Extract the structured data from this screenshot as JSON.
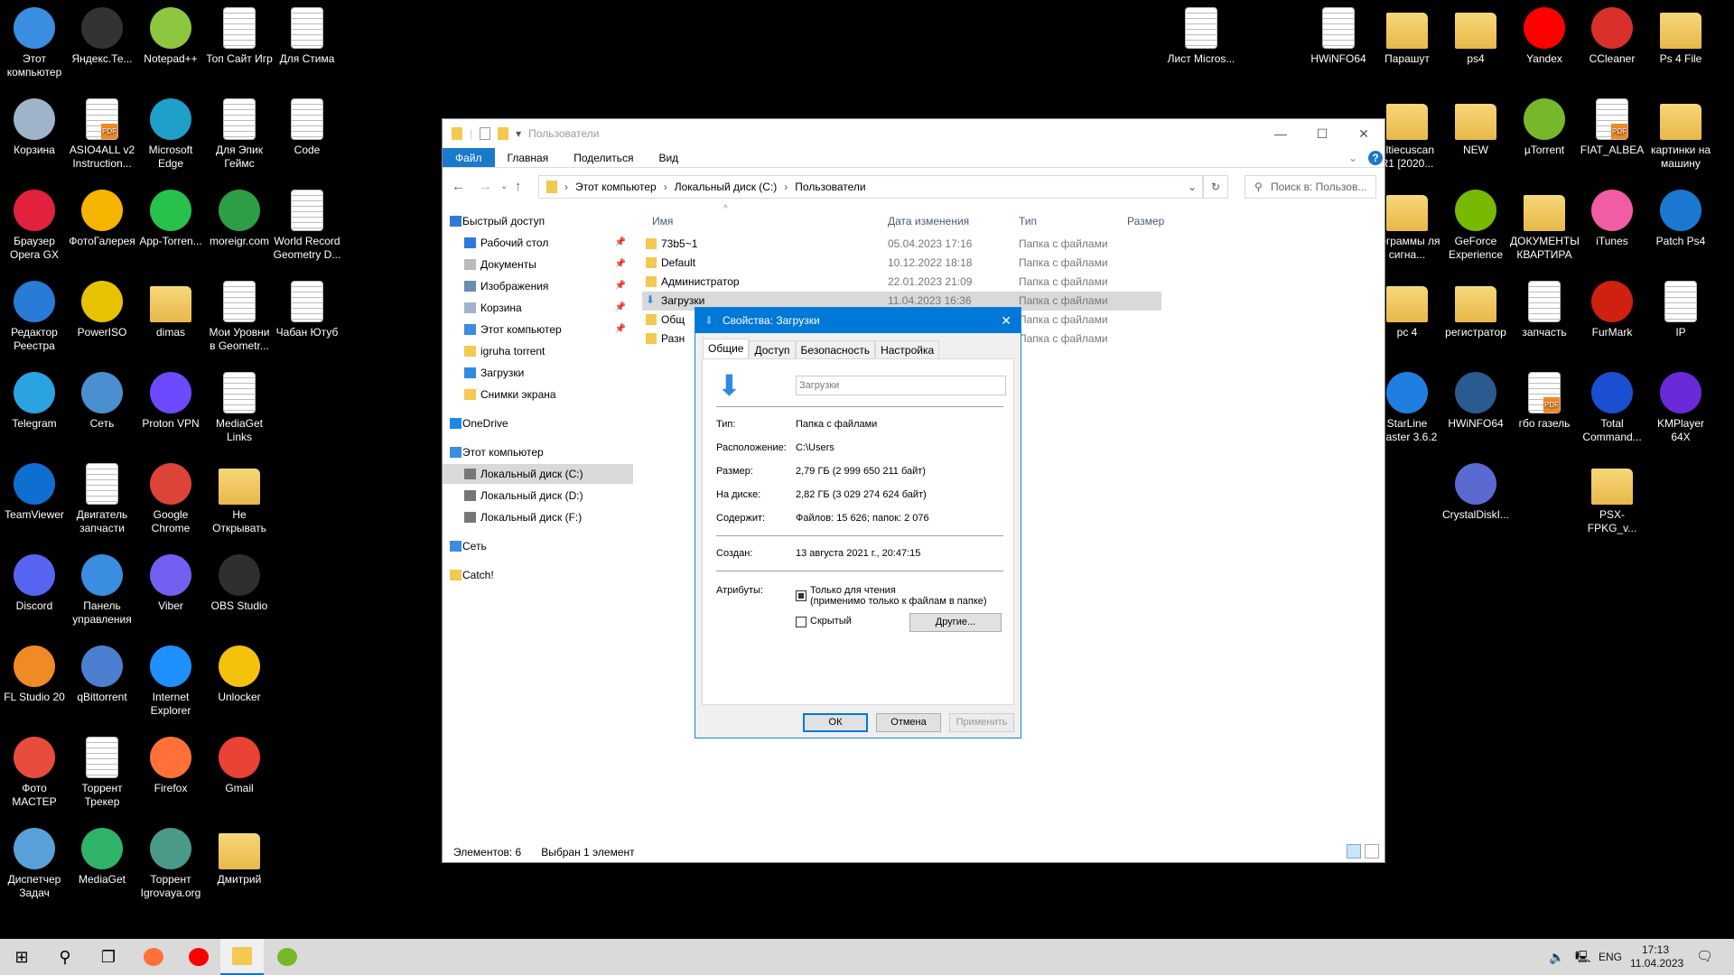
{
  "desktop": {
    "left_columns": [
      [
        {
          "label": "Этот компьютер",
          "icon": "computer",
          "color": "#3a8de0"
        },
        {
          "label": "Корзина",
          "icon": "recycle-bin",
          "color": "#9fb4c8"
        },
        {
          "label": "Браузер Opera GX",
          "icon": "opera-gx",
          "color": "#e2213d"
        },
        {
          "label": "Редактор Реестра",
          "icon": "regedit",
          "color": "#2a7ad8"
        },
        {
          "label": "Telegram",
          "icon": "telegram",
          "color": "#2aa3e0"
        },
        {
          "label": "TeamViewer",
          "icon": "teamviewer",
          "color": "#0e6fd0"
        },
        {
          "label": "Discord",
          "icon": "discord",
          "color": "#5865f2"
        },
        {
          "label": "FL Studio 20",
          "icon": "fl-studio",
          "color": "#f08a24"
        },
        {
          "label": "Фото МАСТЕР",
          "icon": "photo-master",
          "color": "#e84c3d"
        },
        {
          "label": "Диспетчер Задач",
          "icon": "task-manager",
          "color": "#5aa0d8"
        }
      ],
      [
        {
          "label": "Яндекс.Те...",
          "icon": "yandex-telemost",
          "color": "#333333"
        },
        {
          "label": "ASIO4ALL v2 Instruction...",
          "icon": "pdf",
          "color": "#eeeeee"
        },
        {
          "label": "ФотоГалерея",
          "icon": "photo-gallery",
          "color": "#f4b400"
        },
        {
          "label": "PowerISO",
          "icon": "poweriso",
          "color": "#e8c200"
        },
        {
          "label": "Сеть",
          "icon": "network",
          "color": "#4a90d0"
        },
        {
          "label": "Двигатель запчасти",
          "icon": "word-doc",
          "color": "#2b5797"
        },
        {
          "label": "Панель управления",
          "icon": "control-panel",
          "color": "#3a8de0"
        },
        {
          "label": "qBittorrent",
          "icon": "qbittorrent",
          "color": "#4c7fd0"
        },
        {
          "label": "Торрент Трекер",
          "icon": "doc",
          "color": "#ffffff"
        },
        {
          "label": "MediaGet",
          "icon": "mediaget",
          "color": "#2fb36b"
        }
      ],
      [
        {
          "label": "Notepad++",
          "icon": "notepad-plus",
          "color": "#8dc63f"
        },
        {
          "label": "Microsoft Edge",
          "icon": "edge",
          "color": "#1fa0c8"
        },
        {
          "label": "App-Torren...",
          "icon": "app-torrent",
          "color": "#27c24c"
        },
        {
          "label": "dimas",
          "icon": "user-folder",
          "color": "#e8b84a"
        },
        {
          "label": "Proton VPN",
          "icon": "proton-vpn",
          "color": "#6d4aff"
        },
        {
          "label": "Google Chrome",
          "icon": "chrome",
          "color": "#db4437"
        },
        {
          "label": "Viber",
          "icon": "viber",
          "color": "#7360f2"
        },
        {
          "label": "Internet Explorer",
          "icon": "internet-explorer",
          "color": "#1e90ff"
        },
        {
          "label": "Firefox",
          "icon": "firefox",
          "color": "#ff7139"
        },
        {
          "label": "Торрент Igrovaya.org",
          "icon": "utorrent",
          "color": "#4a9a8a"
        }
      ],
      [
        {
          "label": "Топ Сайт Игр",
          "icon": "doc",
          "color": "#ffffff"
        },
        {
          "label": "Для Эпик Геймс",
          "icon": "doc",
          "color": "#ffffff"
        },
        {
          "label": "moreigr.com",
          "icon": "moreigr",
          "color": "#2e9e44"
        },
        {
          "label": "Мои Уровни в Geometr...",
          "icon": "doc",
          "color": "#ffffff"
        },
        {
          "label": "MediaGet Links",
          "icon": "doc",
          "color": "#ffffff"
        },
        {
          "label": "Не Открывать",
          "icon": "folder",
          "color": "#e8b84a"
        },
        {
          "label": "OBS Studio",
          "icon": "obs",
          "color": "#302e31"
        },
        {
          "label": "Unlocker",
          "icon": "unlocker",
          "color": "#f4c20d"
        },
        {
          "label": "Gmail",
          "icon": "gmail",
          "color": "#ea4335"
        },
        {
          "label": "Дмитрий",
          "icon": "folder",
          "color": "#e8b84a"
        }
      ],
      [
        {
          "label": "Для Стима",
          "icon": "doc",
          "color": "#ffffff"
        },
        {
          "label": "Code",
          "icon": "doc",
          "color": "#ffffff"
        },
        {
          "label": "World Record Geometry D...",
          "icon": "doc",
          "color": "#ffffff"
        },
        {
          "label": "Чабан Ютуб",
          "icon": "doc",
          "color": "#ffffff"
        }
      ]
    ],
    "right_columns": [
      [
        {
          "label": "Лист Micros...",
          "icon": "excel",
          "color": "#1d7044"
        }
      ],
      [
        {
          "label": "HWiNFO64",
          "icon": "doc",
          "color": "#ffffff"
        }
      ],
      [
        {
          "label": "Парашут",
          "icon": "folder",
          "color": "#e8b84a"
        },
        {
          "label": "ultiecuscan R1 [2020...",
          "icon": "folder",
          "color": "#e8b84a"
        },
        {
          "label": "рограммы ля сигна...",
          "icon": "folder",
          "color": "#e8b84a"
        },
        {
          "label": "pc 4",
          "icon": "folder",
          "color": "#e8b84a"
        },
        {
          "label": "StarLine Master 3.6.2",
          "icon": "starline",
          "color": "#1f7fe0"
        }
      ],
      [
        {
          "label": "ps4",
          "icon": "folder",
          "color": "#e8b84a"
        },
        {
          "label": "NEW",
          "icon": "folder",
          "color": "#e8b84a"
        },
        {
          "label": "GeForce Experience",
          "icon": "geforce",
          "color": "#76b900"
        },
        {
          "label": "регистратор",
          "icon": "folder",
          "color": "#e8b84a"
        },
        {
          "label": "HWiNFO64",
          "icon": "hwinfo",
          "color": "#2a5a90"
        },
        {
          "label": "CrystalDiskI...",
          "icon": "crystaldisk",
          "color": "#5a6ad0"
        }
      ],
      [
        {
          "label": "Yandex",
          "icon": "yandex",
          "color": "#ff0000"
        },
        {
          "label": "µTorrent",
          "icon": "utorrent",
          "color": "#77b82a"
        },
        {
          "label": "ДОКУМЕНТЫ КВАРТИРА",
          "icon": "folder",
          "color": "#e8b84a"
        },
        {
          "label": "запчасть",
          "icon": "doc",
          "color": "#ffffff"
        },
        {
          "label": "гбо газель",
          "icon": "pdf",
          "color": "#eeeeee"
        }
      ],
      [
        {
          "label": "CCleaner",
          "icon": "ccleaner",
          "color": "#d9302c"
        },
        {
          "label": "FIAT_ALBEA",
          "icon": "pdf",
          "color": "#c8202a"
        },
        {
          "label": "iTunes",
          "icon": "itunes",
          "color": "#f25ca2"
        },
        {
          "label": "FurMark",
          "icon": "furmark",
          "color": "#d02010"
        },
        {
          "label": "Total Command...",
          "icon": "total-commander",
          "color": "#1a4fd0"
        },
        {
          "label": "PSX-FPKG_v...",
          "icon": "folder",
          "color": "#e8b84a"
        }
      ],
      [
        {
          "label": "Ps 4 File",
          "icon": "folder",
          "color": "#e8b84a"
        },
        {
          "label": "картинки на машину",
          "icon": "folder",
          "color": "#e8b84a"
        },
        {
          "label": "Patch Ps4",
          "icon": "patch",
          "color": "#1a78d0"
        },
        {
          "label": "IP",
          "icon": "doc",
          "color": "#ffffff"
        },
        {
          "label": "KMPlayer 64X",
          "icon": "kmplayer",
          "color": "#6a2ad8"
        }
      ]
    ]
  },
  "explorer": {
    "title": "Пользователи",
    "ribbon_tabs": [
      "Файл",
      "Главная",
      "Поделиться",
      "Вид"
    ],
    "breadcrumb": [
      "Этот компьютер",
      "Локальный диск (C:)",
      "Пользователи"
    ],
    "search_placeholder": "Поиск в: Пользов...",
    "sidebar": [
      {
        "label": "Быстрый доступ",
        "level": 0,
        "icon": "star-icon"
      },
      {
        "label": "Рабочий стол",
        "level": 1,
        "icon": "desktop-icon",
        "pinned": true
      },
      {
        "label": "Документы",
        "level": 1,
        "icon": "documents-icon",
        "pinned": true
      },
      {
        "label": "Изображения",
        "level": 1,
        "icon": "pictures-icon",
        "pinned": true
      },
      {
        "label": "Корзина",
        "level": 1,
        "icon": "recycle-bin-icon",
        "pinned": true
      },
      {
        "label": "Этот компьютер",
        "level": 1,
        "icon": "computer-icon",
        "pinned": true
      },
      {
        "label": "igruha torrent",
        "level": 1,
        "icon": "folder-icon"
      },
      {
        "label": "Загрузки",
        "level": 1,
        "icon": "downloads-icon"
      },
      {
        "label": "Снимки экрана",
        "level": 1,
        "icon": "folder-icon"
      },
      {
        "label": "OneDrive",
        "level": 0,
        "icon": "onedrive-icon"
      },
      {
        "label": "Этот компьютер",
        "level": 0,
        "icon": "computer-icon"
      },
      {
        "label": "Локальный диск (C:)",
        "level": 1,
        "icon": "drive-icon",
        "selected": true
      },
      {
        "label": "Локальный диск (D:)",
        "level": 1,
        "icon": "drive-icon"
      },
      {
        "label": "Локальный диск (F:)",
        "level": 1,
        "icon": "drive-icon"
      },
      {
        "label": "Сеть",
        "level": 0,
        "icon": "network-icon"
      },
      {
        "label": "Catch!",
        "level": 0,
        "icon": "folder-icon"
      }
    ],
    "columns": [
      "Имя",
      "Дата изменения",
      "Тип",
      "Размер"
    ],
    "rows": [
      {
        "name": "73b5~1",
        "date": "05.04.2023 17:16",
        "type": "Папка с файлами"
      },
      {
        "name": "Default",
        "date": "10.12.2022 18:18",
        "type": "Папка с файлами"
      },
      {
        "name": "Администратор",
        "date": "22.01.2023 21:09",
        "type": "Папка с файлами"
      },
      {
        "name": "Загрузки",
        "date": "11.04.2023 16:36",
        "type": "Папка с файлами",
        "selected": true
      },
      {
        "name": "Общ",
        "date": "",
        "type": "Папка с файлами"
      },
      {
        "name": "Разн",
        "date": "",
        "type": "Папка с файлами"
      }
    ],
    "status_items": "Элементов: 6",
    "status_selected": "Выбран 1 элемент"
  },
  "dialog": {
    "title": "Свойства: Загрузки",
    "tabs": [
      "Общие",
      "Доступ",
      "Безопасность",
      "Настройка"
    ],
    "name_value": "Загрузки",
    "fields": [
      {
        "label": "Тип:",
        "value": "Папка с файлами"
      },
      {
        "label": "Расположение:",
        "value": "C:\\Users"
      },
      {
        "label": "Размер:",
        "value": "2,79 ГБ (2 999 650 211 байт)"
      },
      {
        "label": "На диске:",
        "value": "2,82 ГБ (3 029 274 624 байт)"
      },
      {
        "label": "Содержит:",
        "value": "Файлов: 15 626; папок: 2 076"
      }
    ],
    "created_label": "Создан:",
    "created_value": "13 августа 2021 г., 20:47:15",
    "attributes_label": "Атрибуты:",
    "readonly_label": "Только для чтения",
    "readonly_note": "(применимо только к файлам в папке)",
    "readonly_state": "indeterminate",
    "hidden_label": "Скрытый",
    "hidden_checked": false,
    "other_button": "Другие...",
    "ok": "ОК",
    "cancel": "Отмена",
    "apply": "Применить"
  },
  "taskbar": {
    "apps": [
      {
        "name": "start",
        "color": "#000000"
      },
      {
        "name": "search",
        "color": "#000000"
      },
      {
        "name": "task-view",
        "color": "#000000"
      },
      {
        "name": "firefox",
        "color": "#ff7139"
      },
      {
        "name": "yandex",
        "color": "#ff0000"
      },
      {
        "name": "file-explorer",
        "color": "#f3c94f",
        "active": true
      },
      {
        "name": "utorrent",
        "color": "#77b82a"
      }
    ],
    "language": "ENG",
    "time": "17:13",
    "date": "11.04.2023"
  },
  "colors": {
    "accent": "#0078d7",
    "selection": "#d9d9d9"
  }
}
